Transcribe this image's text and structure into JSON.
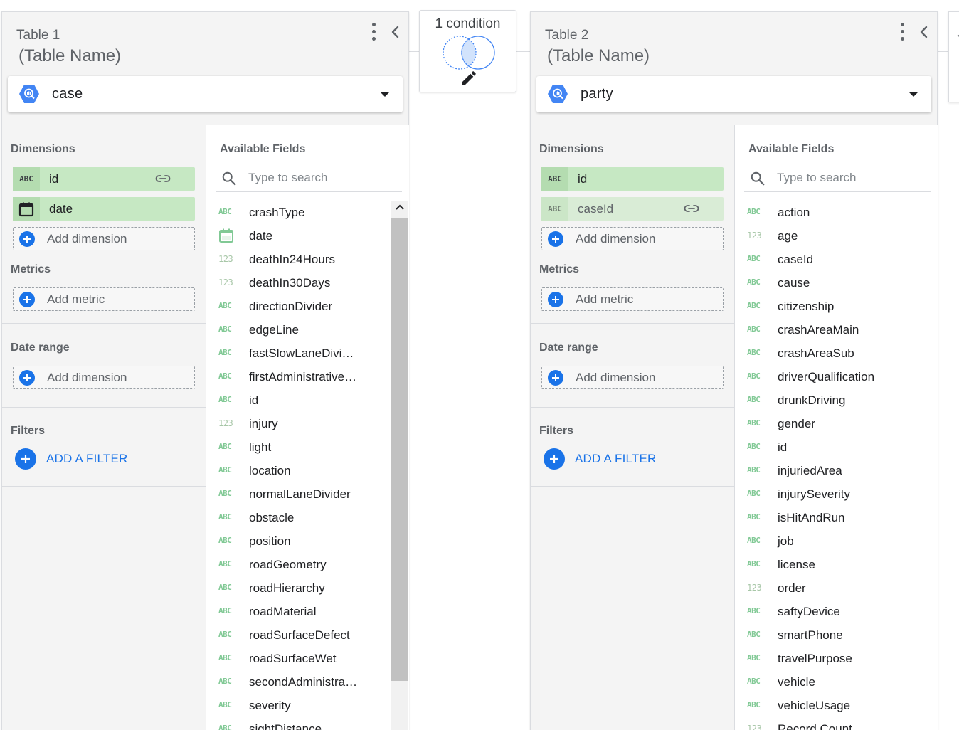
{
  "join": {
    "condition_label": "1 condition"
  },
  "tables": [
    {
      "number_label": "Table 1",
      "name_placeholder": "(Table Name)",
      "source": "case",
      "sections": {
        "dimensions": "Dimensions",
        "metrics": "Metrics",
        "date_range": "Date range",
        "filters": "Filters"
      },
      "dimensions": [
        {
          "label": "id",
          "type": "ABC",
          "linked": true,
          "faded": false
        },
        {
          "label": "date",
          "type": "calendar",
          "linked": false,
          "faded": false
        }
      ],
      "add_dimension": "Add dimension",
      "add_metric": "Add metric",
      "add_date_dimension": "Add dimension",
      "add_filter": "ADD A FILTER",
      "available_fields_title": "Available Fields",
      "search_placeholder": "Type to search",
      "fields": [
        {
          "name": "crashType",
          "type": "ABC"
        },
        {
          "name": "date",
          "type": "calendar"
        },
        {
          "name": "deathIn24Hours",
          "type": "123"
        },
        {
          "name": "deathIn30Days",
          "type": "123"
        },
        {
          "name": "directionDivider",
          "type": "ABC"
        },
        {
          "name": "edgeLine",
          "type": "ABC"
        },
        {
          "name": "fastSlowLaneDivi…",
          "type": "ABC"
        },
        {
          "name": "firstAdministrative…",
          "type": "ABC"
        },
        {
          "name": "id",
          "type": "ABC"
        },
        {
          "name": "injury",
          "type": "123"
        },
        {
          "name": "light",
          "type": "ABC"
        },
        {
          "name": "location",
          "type": "ABC"
        },
        {
          "name": "normalLaneDivider",
          "type": "ABC"
        },
        {
          "name": "obstacle",
          "type": "ABC"
        },
        {
          "name": "position",
          "type": "ABC"
        },
        {
          "name": "roadGeometry",
          "type": "ABC"
        },
        {
          "name": "roadHierarchy",
          "type": "ABC"
        },
        {
          "name": "roadMaterial",
          "type": "ABC"
        },
        {
          "name": "roadSurfaceDefect",
          "type": "ABC"
        },
        {
          "name": "roadSurfaceWet",
          "type": "ABC"
        },
        {
          "name": "secondAdministra…",
          "type": "ABC"
        },
        {
          "name": "severity",
          "type": "ABC"
        },
        {
          "name": "sightDistance",
          "type": "ABC"
        }
      ]
    },
    {
      "number_label": "Table 2",
      "name_placeholder": "(Table Name)",
      "source": "party",
      "sections": {
        "dimensions": "Dimensions",
        "metrics": "Metrics",
        "date_range": "Date range",
        "filters": "Filters"
      },
      "dimensions": [
        {
          "label": "id",
          "type": "ABC",
          "linked": false,
          "faded": false
        },
        {
          "label": "caseId",
          "type": "ABC",
          "linked": true,
          "faded": true
        }
      ],
      "add_dimension": "Add dimension",
      "add_metric": "Add metric",
      "add_date_dimension": "Add dimension",
      "add_filter": "ADD A FILTER",
      "available_fields_title": "Available Fields",
      "search_placeholder": "Type to search",
      "fields": [
        {
          "name": "action",
          "type": "ABC"
        },
        {
          "name": "age",
          "type": "123"
        },
        {
          "name": "caseId",
          "type": "ABC"
        },
        {
          "name": "cause",
          "type": "ABC"
        },
        {
          "name": "citizenship",
          "type": "ABC"
        },
        {
          "name": "crashAreaMain",
          "type": "ABC"
        },
        {
          "name": "crashAreaSub",
          "type": "ABC"
        },
        {
          "name": "driverQualification",
          "type": "ABC"
        },
        {
          "name": "drunkDriving",
          "type": "ABC"
        },
        {
          "name": "gender",
          "type": "ABC"
        },
        {
          "name": "id",
          "type": "ABC"
        },
        {
          "name": "injuriedArea",
          "type": "ABC"
        },
        {
          "name": "injurySeverity",
          "type": "ABC"
        },
        {
          "name": "isHitAndRun",
          "type": "ABC"
        },
        {
          "name": "job",
          "type": "ABC"
        },
        {
          "name": "license",
          "type": "ABC"
        },
        {
          "name": "order",
          "type": "123"
        },
        {
          "name": "saftyDevice",
          "type": "ABC"
        },
        {
          "name": "smartPhone",
          "type": "ABC"
        },
        {
          "name": "travelPurpose",
          "type": "ABC"
        },
        {
          "name": "vehicle",
          "type": "ABC"
        },
        {
          "name": "vehicleUsage",
          "type": "ABC"
        },
        {
          "name": "Record Count",
          "type": "123"
        }
      ]
    }
  ],
  "colors": {
    "panel_bg": "#f4f4f4",
    "chip_bg": "#c6e8c3",
    "accent_blue": "#1a73e8",
    "field_type_green": "#81c995"
  }
}
